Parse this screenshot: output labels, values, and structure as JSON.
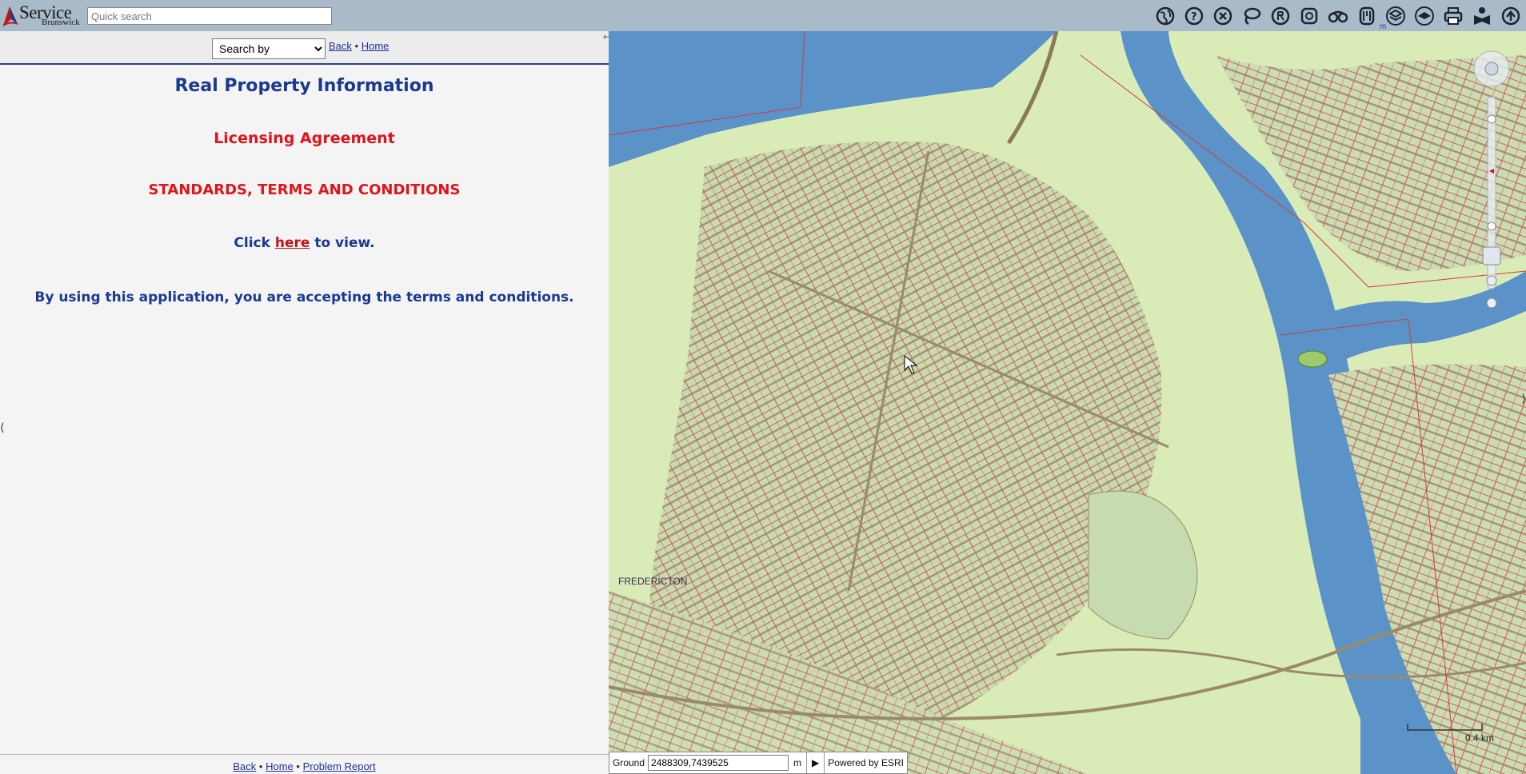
{
  "header": {
    "logo_line1": "Service",
    "logo_line2": "Brunswick",
    "quick_search_placeholder": "Quick search",
    "unit_label": "m",
    "tools": [
      {
        "name": "globe-icon"
      },
      {
        "name": "help-cursor-icon"
      },
      {
        "name": "clear-icon"
      },
      {
        "name": "lasso-icon"
      },
      {
        "name": "identify-icon"
      },
      {
        "name": "select-area-icon"
      },
      {
        "name": "binoculars-icon"
      },
      {
        "name": "measure-icon"
      },
      {
        "name": "layers-icon"
      },
      {
        "name": "basemap-icon"
      },
      {
        "name": "print-icon"
      },
      {
        "name": "user-guide-icon"
      },
      {
        "name": "about-icon"
      }
    ]
  },
  "panel": {
    "search_by": "Search by",
    "back": "Back",
    "home": "Home",
    "sep": "•",
    "title": "Real Property Information",
    "licensing": "Licensing Agreement",
    "standards": "STANDARDS, TERMS AND CONDITIONS",
    "click_pre": "Click ",
    "click_link": "here",
    "click_post": " to view.",
    "accept": "By using this application, you are accepting the terms and conditions.",
    "footer_back": "Back",
    "footer_home": "Home",
    "footer_report": "Problem Report"
  },
  "map": {
    "city_label": "FREDERICTON",
    "coord_label": "Ground",
    "coord_value": "2488309,7439525",
    "coord_unit": "m",
    "powered_by": "Powered by ESRI",
    "scale_text": "0.4 km",
    "colors": {
      "water": "#5b93c9",
      "land": "#d9ecb8",
      "urban": "#c9dcb4",
      "parcel": "#d23a3a",
      "road": "#9a8a6a"
    }
  }
}
